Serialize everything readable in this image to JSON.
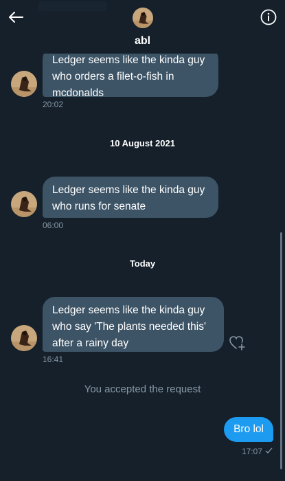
{
  "header": {
    "title": "abl",
    "back_icon": "arrow-left-icon",
    "info_icon": "info-icon"
  },
  "colors": {
    "background": "#15202b",
    "incoming_bubble": "#3d5466",
    "outgoing_bubble": "#1d9bf0",
    "muted_text": "#8899a6"
  },
  "messages": [
    {
      "text": "Ledger seems like the kinda guy\nwho orders a filet-o-fish in\nmcdonalds",
      "time": "20:02"
    },
    {
      "text": "Ledger seems like the kinda guy\nwho runs for senate",
      "time": "06:00"
    },
    {
      "text": "Ledger seems like the kinda guy\nwho say 'The plants needed this'\nafter a rainy day",
      "time": "16:41"
    }
  ],
  "separators": {
    "date1": "10 August 2021",
    "date2": "Today"
  },
  "system_message": "You accepted the request",
  "outgoing": {
    "text": "Bro lol",
    "time": "17:07",
    "status_icon": "check-icon"
  },
  "reaction_icon": "heart-add-icon"
}
